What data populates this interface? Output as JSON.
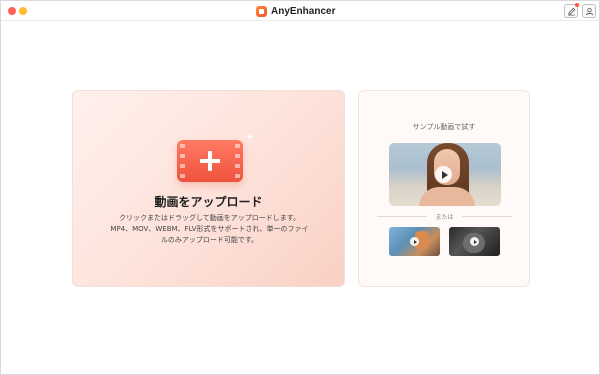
{
  "window": {
    "app_name": "AnyEnhancer"
  },
  "titlebar": {
    "icons": [
      "close-dot",
      "minimize-dot",
      "app-logo-icon",
      "edit-icon",
      "user-icon"
    ]
  },
  "upload": {
    "title": "動画をアップロード",
    "desc_line1": "クリックまたはドラッグして動画をアップロードします。",
    "desc_line2": "MP4、MOV、WEBM、FLV形式をサポートされ、単一のファイ",
    "desc_line3": "ルのみアップロード可能です。"
  },
  "sample": {
    "title": "サンプル動画で試す",
    "or_label": "または"
  },
  "colors": {
    "accent": "#f0533e",
    "upload_bg": "#fde2da",
    "close": "#fe5f57",
    "minimize": "#febc2e"
  }
}
